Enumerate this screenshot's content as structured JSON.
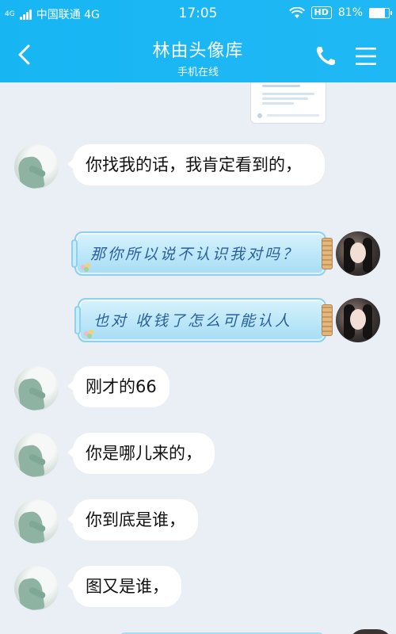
{
  "status_bar": {
    "network_badge": "4G",
    "carrier": "中国联通 4G",
    "time": "17:05",
    "hd_label": "HD",
    "battery_percent": "81%",
    "battery_level": 0.81
  },
  "header": {
    "title": "林由头像库",
    "subtitle": "手机在线",
    "background": "#1fb8f5"
  },
  "messages": [
    {
      "side": "left",
      "type": "text",
      "text": "你找我的话，我肯定看到的，"
    },
    {
      "side": "right",
      "type": "bottle",
      "text": "那你所以说不认识我对吗？"
    },
    {
      "side": "right",
      "type": "bottle",
      "text": "也对  收钱了怎么可能认人"
    },
    {
      "side": "left",
      "type": "text",
      "text": "刚才的66"
    },
    {
      "side": "left",
      "type": "text",
      "text": "你是哪儿来的，"
    },
    {
      "side": "left",
      "type": "text",
      "text": "你到底是谁，"
    },
    {
      "side": "left",
      "type": "text",
      "text": "图又是谁，"
    }
  ],
  "icons": {
    "back": "chevron-left-icon",
    "call": "phone-icon",
    "menu": "hamburger-menu-icon"
  },
  "colors": {
    "chat_background": "#eaeef5",
    "bubble": "#ffffff",
    "bottle_text": "#2a5f9a"
  }
}
